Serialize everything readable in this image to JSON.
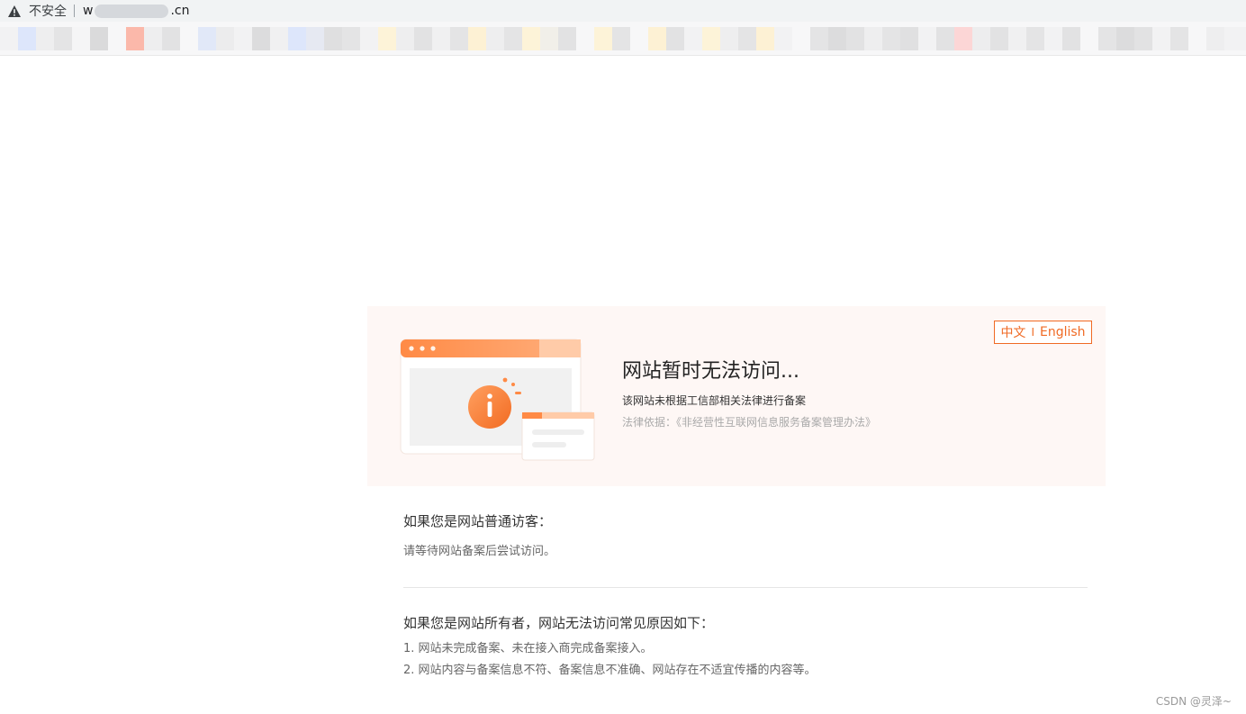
{
  "browser": {
    "security_label": "不安全",
    "url_prefix": "w",
    "url_suffix": ".cn",
    "warning_icon": "warning-triangle-icon"
  },
  "banner": {
    "lang_zh": "中文",
    "lang_sep": "I",
    "lang_en": "English",
    "title": "网站暂时无法访问...",
    "subtitle": "该网站未根据工信部相关法律进行备案",
    "law_basis": "法律依据：《非经营性互联网信息服务备案管理办法》",
    "accent_color": "#f06a24",
    "background_color": "#fef7f5"
  },
  "visitor": {
    "heading": "如果您是网站普通访客：",
    "text": "请等待网站备案后尝试访问。"
  },
  "owner": {
    "heading": "如果您是网站所有者，网站无法访问常见原因如下：",
    "reasons": [
      "1. 网站未完成备案、未在接入商完成备案接入。",
      "2. 网站内容与备案信息不符、备案信息不准确、网站存在不适宜传播的内容等。"
    ]
  },
  "watermark": "CSDN @灵泽~"
}
